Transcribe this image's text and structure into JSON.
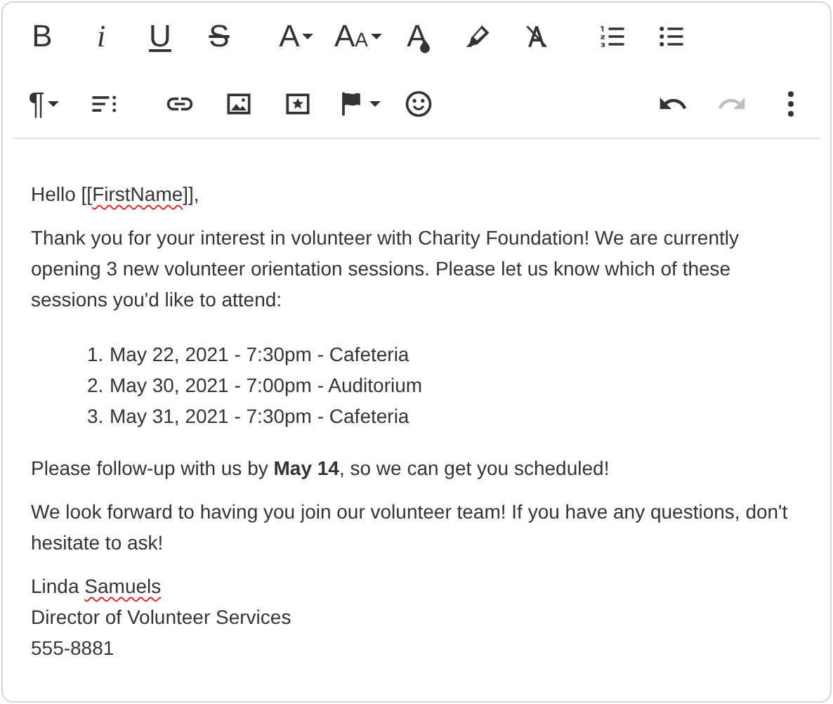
{
  "toolbar_rows": [
    [
      {
        "kind": "bold",
        "glyph": "B"
      },
      {
        "kind": "italic",
        "glyph": "i"
      },
      {
        "kind": "underline",
        "glyph": "U"
      },
      {
        "kind": "strikethrough",
        "glyph": "S"
      },
      {
        "kind": "font",
        "glyph": "A",
        "dropdown": true
      },
      {
        "kind": "font-size",
        "glyph": "AA",
        "dropdown": true
      },
      {
        "kind": "text-color",
        "glyph": "A"
      },
      {
        "kind": "highlight"
      },
      {
        "kind": "clear-format"
      },
      {
        "kind": "ordered-list"
      },
      {
        "kind": "bullet-list"
      }
    ],
    [
      {
        "kind": "paragraph",
        "glyph": "¶",
        "dropdown": true
      },
      {
        "kind": "line-height"
      },
      {
        "kind": "link"
      },
      {
        "kind": "image"
      },
      {
        "kind": "media"
      },
      {
        "kind": "flag",
        "dropdown": true
      },
      {
        "kind": "emoji"
      },
      {
        "kind": "undo",
        "disabled": false
      },
      {
        "kind": "redo",
        "disabled": true
      },
      {
        "kind": "more"
      }
    ]
  ],
  "body": [
    {
      "kind": "paragraph",
      "segments": [
        {
          "text": "Hello [["
        },
        {
          "text": "FirstName",
          "misspelled": true
        },
        {
          "text": "]],"
        }
      ]
    },
    {
      "kind": "paragraph",
      "segments": [
        {
          "text": "Thank you for your interest in volunteer with Charity Foundation! We are currently opening 3 new volunteer orientation sessions. Please let us know which of these sessions you'd like to attend:"
        }
      ]
    },
    {
      "kind": "list",
      "items": [
        {
          "number": "1.",
          "text": "May 22, 2021 - 7:30pm - Cafeteria"
        },
        {
          "number": "2.",
          "text": "May 30, 2021 - 7:00pm - Auditorium"
        },
        {
          "number": "3.",
          "text": "May 31, 2021 - 7:30pm - Cafeteria"
        }
      ]
    },
    {
      "kind": "paragraph",
      "segments": [
        {
          "text": "Please follow-up with us by **May 14**, so we can get you scheduled!"
        }
      ]
    },
    {
      "kind": "paragraph",
      "segments": [
        {
          "text": "We look forward to having you join our volunteer team! If you have any questions, don't hesitate to ask!"
        }
      ]
    },
    {
      "kind": "lines",
      "lines": [
        [
          {
            "text": "Linda "
          },
          {
            "text": "Samuels",
            "misspelled": true
          }
        ],
        [
          {
            "text": "Director of Volunteer Services"
          }
        ],
        [
          {
            "text": "555-8881"
          }
        ]
      ]
    }
  ]
}
